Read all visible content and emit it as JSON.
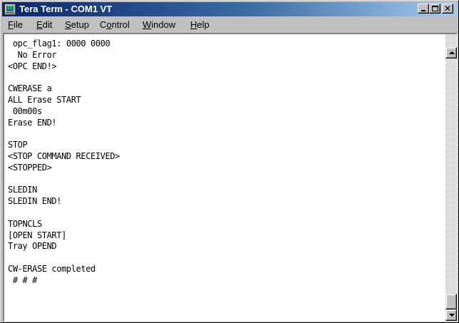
{
  "window": {
    "title": "Tera Term - COM1 VT",
    "app_icon": "teraterm-icon",
    "title_icon_text": "TT",
    "controls": {
      "minimize": "minimize-icon",
      "maximize": "maximize-icon",
      "close": "close-icon",
      "close_glyph": "✕"
    }
  },
  "menu": {
    "items": [
      {
        "label": "File",
        "mnemonic": "F",
        "rest": "ile"
      },
      {
        "label": "Edit",
        "mnemonic": "E",
        "rest": "dit"
      },
      {
        "label": "Setup",
        "mnemonic": "S",
        "rest": "etup"
      },
      {
        "label": "Control",
        "pre": "C",
        "mnemonic": "o",
        "rest": "ntrol"
      },
      {
        "label": "Window",
        "mnemonic": "W",
        "rest": "indow"
      },
      {
        "label": "Help",
        "mnemonic": "H",
        "rest": "elp"
      }
    ]
  },
  "terminal": {
    "lines": [
      " opc_flag1: 0000 0000",
      "  No Error",
      "<OPC END!>",
      "",
      "CWERASE a",
      "ALL Erase START",
      " 00m00s",
      "Erase END!",
      "",
      "STOP",
      "<STOP COMMAND RECEIVED>",
      "<STOPPED>",
      "",
      "SLEDIN",
      "SLEDIN END!",
      "",
      "TOPNCLS",
      "[OPEN START]",
      "Tray OPEND",
      "",
      "CW-ERASE completed",
      " # # #"
    ]
  },
  "scrollbar": {
    "up": "scroll-up-arrow-icon",
    "down": "scroll-down-arrow-icon",
    "position": 0.96
  },
  "colors": {
    "titlebar_start": "#0a246a",
    "titlebar_end": "#a6caf0",
    "chrome": "#c0c0c0",
    "terminal_bg": "#ffffff",
    "terminal_fg": "#000000"
  }
}
